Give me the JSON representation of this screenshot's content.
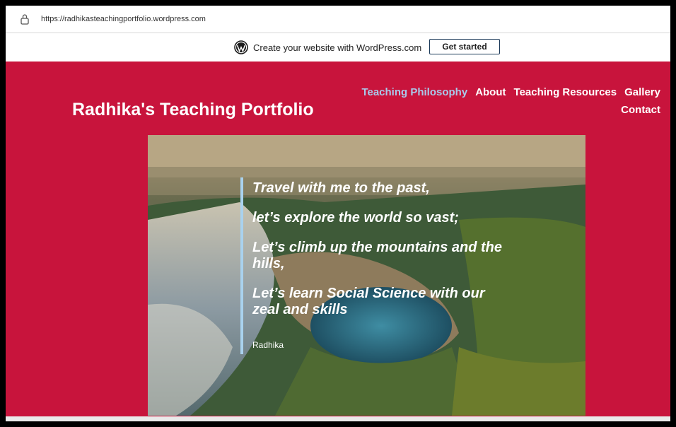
{
  "browser": {
    "url": "https://radhikasteachingportfolio.wordpress.com"
  },
  "wp_banner": {
    "text": "Create your website with WordPress.com",
    "button": "Get started"
  },
  "site": {
    "title": "Radhika's Teaching Portfolio",
    "nav": [
      {
        "label": "Teaching Philosophy"
      },
      {
        "label": "About"
      },
      {
        "label": "Teaching Resources"
      },
      {
        "label": "Gallery"
      },
      {
        "label": "Contact"
      }
    ]
  },
  "hero": {
    "quote_lines": [
      "Travel with me to the past,",
      "let’s explore the world so vast;",
      "Let’s climb up the mountains and the hills,",
      "Let’s learn Social Science with our zeal and skills"
    ],
    "citation": "Radhika"
  },
  "colors": {
    "brand": "#c8143c",
    "nav_active": "#a9c9ea",
    "quote_bar": "#a9d2ee"
  }
}
